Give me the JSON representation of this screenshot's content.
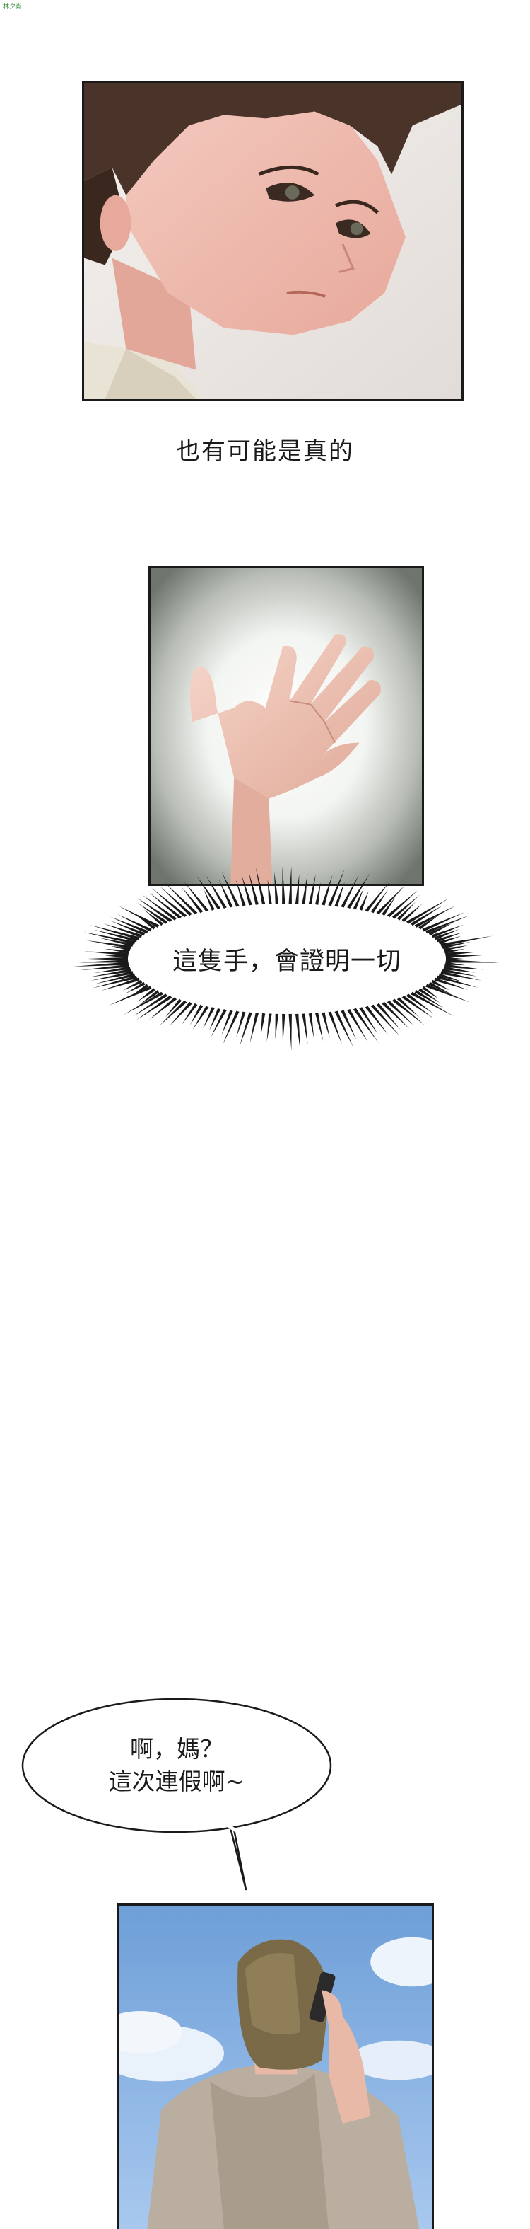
{
  "watermark": "林夕肖",
  "panels": [
    {
      "name": "panel-young-man-face"
    },
    {
      "name": "panel-glowing-hand"
    },
    {
      "name": "panel-woman-on-phone"
    }
  ],
  "narration_1": "也有可能是真的",
  "burst_caption": "這隻手，會證明一切",
  "speech_bubble": {
    "line1": "啊，媽？",
    "line2": "這次連假啊~"
  },
  "colors": {
    "border": "#1a1a1a",
    "sky": "#8fb8e6",
    "skin": "#f2c4b4",
    "hair": "#4a3328"
  }
}
